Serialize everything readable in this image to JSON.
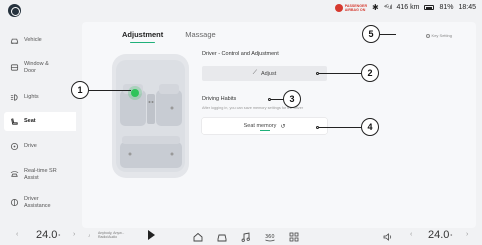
{
  "status": {
    "airbag_line1": "PASSENGER",
    "airbag_line2": "AIRBAG ON",
    "bluetooth": "✱",
    "signal": "⁴ᴳ.ıl",
    "range": "416 km",
    "battery": "81%",
    "time": "18:45"
  },
  "sidebar": {
    "items": [
      {
        "label": "Vehicle",
        "icon": "car-icon"
      },
      {
        "label": "Window & Door",
        "icon": "window-icon"
      },
      {
        "label": "Lights",
        "icon": "light-icon"
      },
      {
        "label": "Seat",
        "icon": "seat-icon"
      },
      {
        "label": "Drive",
        "icon": "steering-icon"
      },
      {
        "label": "Real-time SR Assist",
        "icon": "sr-assist-icon"
      },
      {
        "label": "Driver Assistance",
        "icon": "driver-assist-icon"
      }
    ],
    "active": "Seat"
  },
  "tabs": [
    "Adjustment",
    "Massage"
  ],
  "key_setting": "Key Setting",
  "driver_section": {
    "title": "Driver - Control and Adjustment",
    "adjust_label": "Adjust"
  },
  "habits_section": {
    "title": "Driving Habits",
    "subtitle": "After logging in, you can save memory settings for the driver",
    "memory_label": "Seat memory"
  },
  "callouts": [
    "1",
    "2",
    "3",
    "4",
    "5"
  ],
  "bottom": {
    "temp_left": "24.0",
    "temp_right": "24.0",
    "degree": "°",
    "media_line1": "Anybody, Anyw...",
    "media_line2": "Radio/Audio"
  },
  "colors": {
    "accent": "#1fb07a",
    "seat_dot": "#2ec45a",
    "airbag": "#d63a2f"
  }
}
